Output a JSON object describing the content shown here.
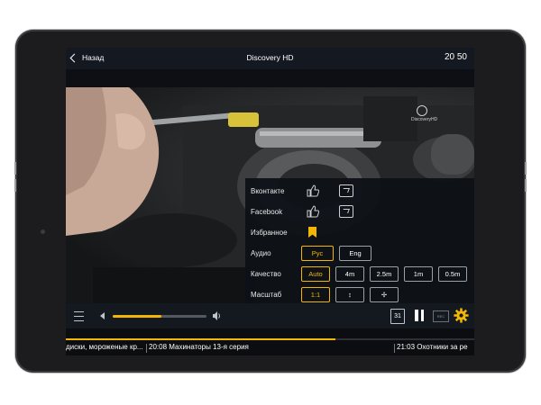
{
  "topbar": {
    "back_label": "Назад",
    "channel_title": "Discovery HD",
    "clock": "20 50"
  },
  "watermark": {
    "logo_text": "DiscoveryHD"
  },
  "menu": {
    "vk_label": "Вконтакте",
    "facebook_label": "Facebook",
    "favorites_label": "Избранное",
    "audio": {
      "label": "Аудио",
      "options": [
        "Рус",
        "Eng"
      ],
      "selected": "Рус"
    },
    "quality": {
      "label": "Качество",
      "options": [
        "Auto",
        "4m",
        "2.5m",
        "1m",
        "0.5m"
      ],
      "selected": "Auto"
    },
    "scale": {
      "label": "Масштаб",
      "options": [
        "1:1",
        "↕",
        "✢"
      ],
      "selected": "1:1"
    }
  },
  "controls": {
    "volume_fraction": 0.52,
    "calendar_day": "31",
    "record_label": "REC"
  },
  "epg": {
    "progress_fraction": 0.66,
    "items": [
      {
        "text": "диски, мороженые кр..."
      },
      {
        "text": "20:08 Махинаторы 13-я серия"
      },
      {
        "text": "21:03 Охотники за ре"
      }
    ]
  },
  "colors": {
    "accent": "#f2b705",
    "bar": "#141920",
    "screen_bg": "#0d0f14"
  },
  "icons": [
    "back-chevron-icon",
    "like-icon",
    "share-icon",
    "bookmark-icon",
    "menu-icon",
    "volume-down-icon",
    "volume-up-icon",
    "calendar-icon",
    "pause-icon",
    "record-icon",
    "gear-icon"
  ]
}
